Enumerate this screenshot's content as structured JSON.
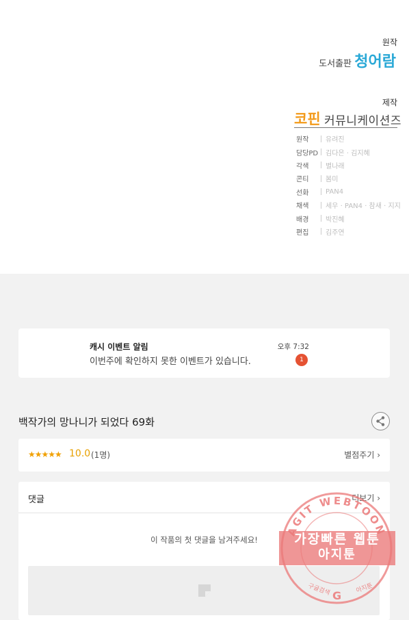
{
  "credits": {
    "original_label": "원작",
    "publisher_small": "도서출판",
    "publisher_big": "청어람",
    "production_label": "제작",
    "studio_highlight": "코핀",
    "studio_rest": "커뮤니케이션즈",
    "staff": [
      {
        "role": "원작",
        "name": "유려진"
      },
      {
        "role": "담당PD",
        "name": "김다은 · 김지혜"
      },
      {
        "role": "각색",
        "name": "별나래"
      },
      {
        "role": "콘티",
        "name": "봄미"
      },
      {
        "role": "선화",
        "name": "PAN4"
      },
      {
        "role": "채색",
        "name": "세우 · PAN4 · 참새 · 지지"
      },
      {
        "role": "배경",
        "name": "박진혜"
      },
      {
        "role": "편집",
        "name": "김주연"
      }
    ]
  },
  "notification": {
    "title": "캐시 이벤트 알림",
    "message": "이번주에 확인하지 못한 이벤트가 있습니다.",
    "time": "오후 7:32",
    "badge": "1"
  },
  "episode": {
    "title": "백작가의 망나니가 되었다 69화",
    "share_icon": "share-icon"
  },
  "rating": {
    "stars": "★★★★★",
    "score": "10.0",
    "count": "(1명)",
    "rate_button": "별점주기 ›",
    "color": "#f0a000"
  },
  "comments": {
    "title": "댓글",
    "more": "더보기 ›",
    "empty_message": "이 작품의 첫 댓글을 남겨주세요!"
  },
  "watermark": {
    "ring_text": "AGIT WEBTOON",
    "banner_line1": "가장빠른 웹툰",
    "banner_line2": "아지툰",
    "bottom_left": "구글검색",
    "bottom_right": "아지툰",
    "color": "#eb7878"
  }
}
